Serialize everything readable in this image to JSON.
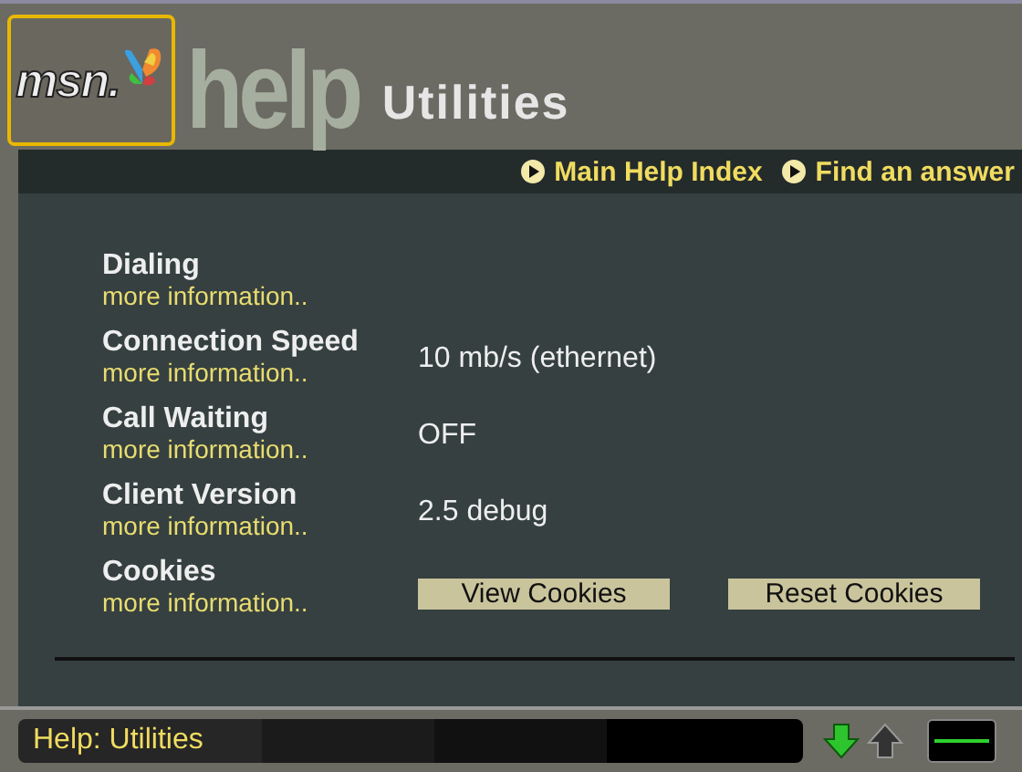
{
  "header": {
    "logo": "msn",
    "logo_mark": ".",
    "section": "help",
    "title": "Utilities"
  },
  "nav_links": [
    {
      "label": "Main Help Index"
    },
    {
      "label": "Find an answer"
    }
  ],
  "settings": [
    {
      "label": "Dialing",
      "link": "more information..",
      "kind": "text"
    },
    {
      "label": "Connection Speed",
      "link": "more information..",
      "kind": "text",
      "value": "10 mb/s (ethernet)"
    },
    {
      "label": "Call Waiting",
      "link": "more information..",
      "kind": "text",
      "value": "OFF"
    },
    {
      "label": "Client Version",
      "link": "more information..",
      "kind": "text",
      "value": "2.5 debug"
    },
    {
      "label": "Cookies",
      "link": "more information..",
      "kind": "buttons",
      "buttons": [
        "View Cookies",
        "Reset Cookies"
      ]
    }
  ],
  "status_bar": {
    "text": "Help: Utilities"
  }
}
